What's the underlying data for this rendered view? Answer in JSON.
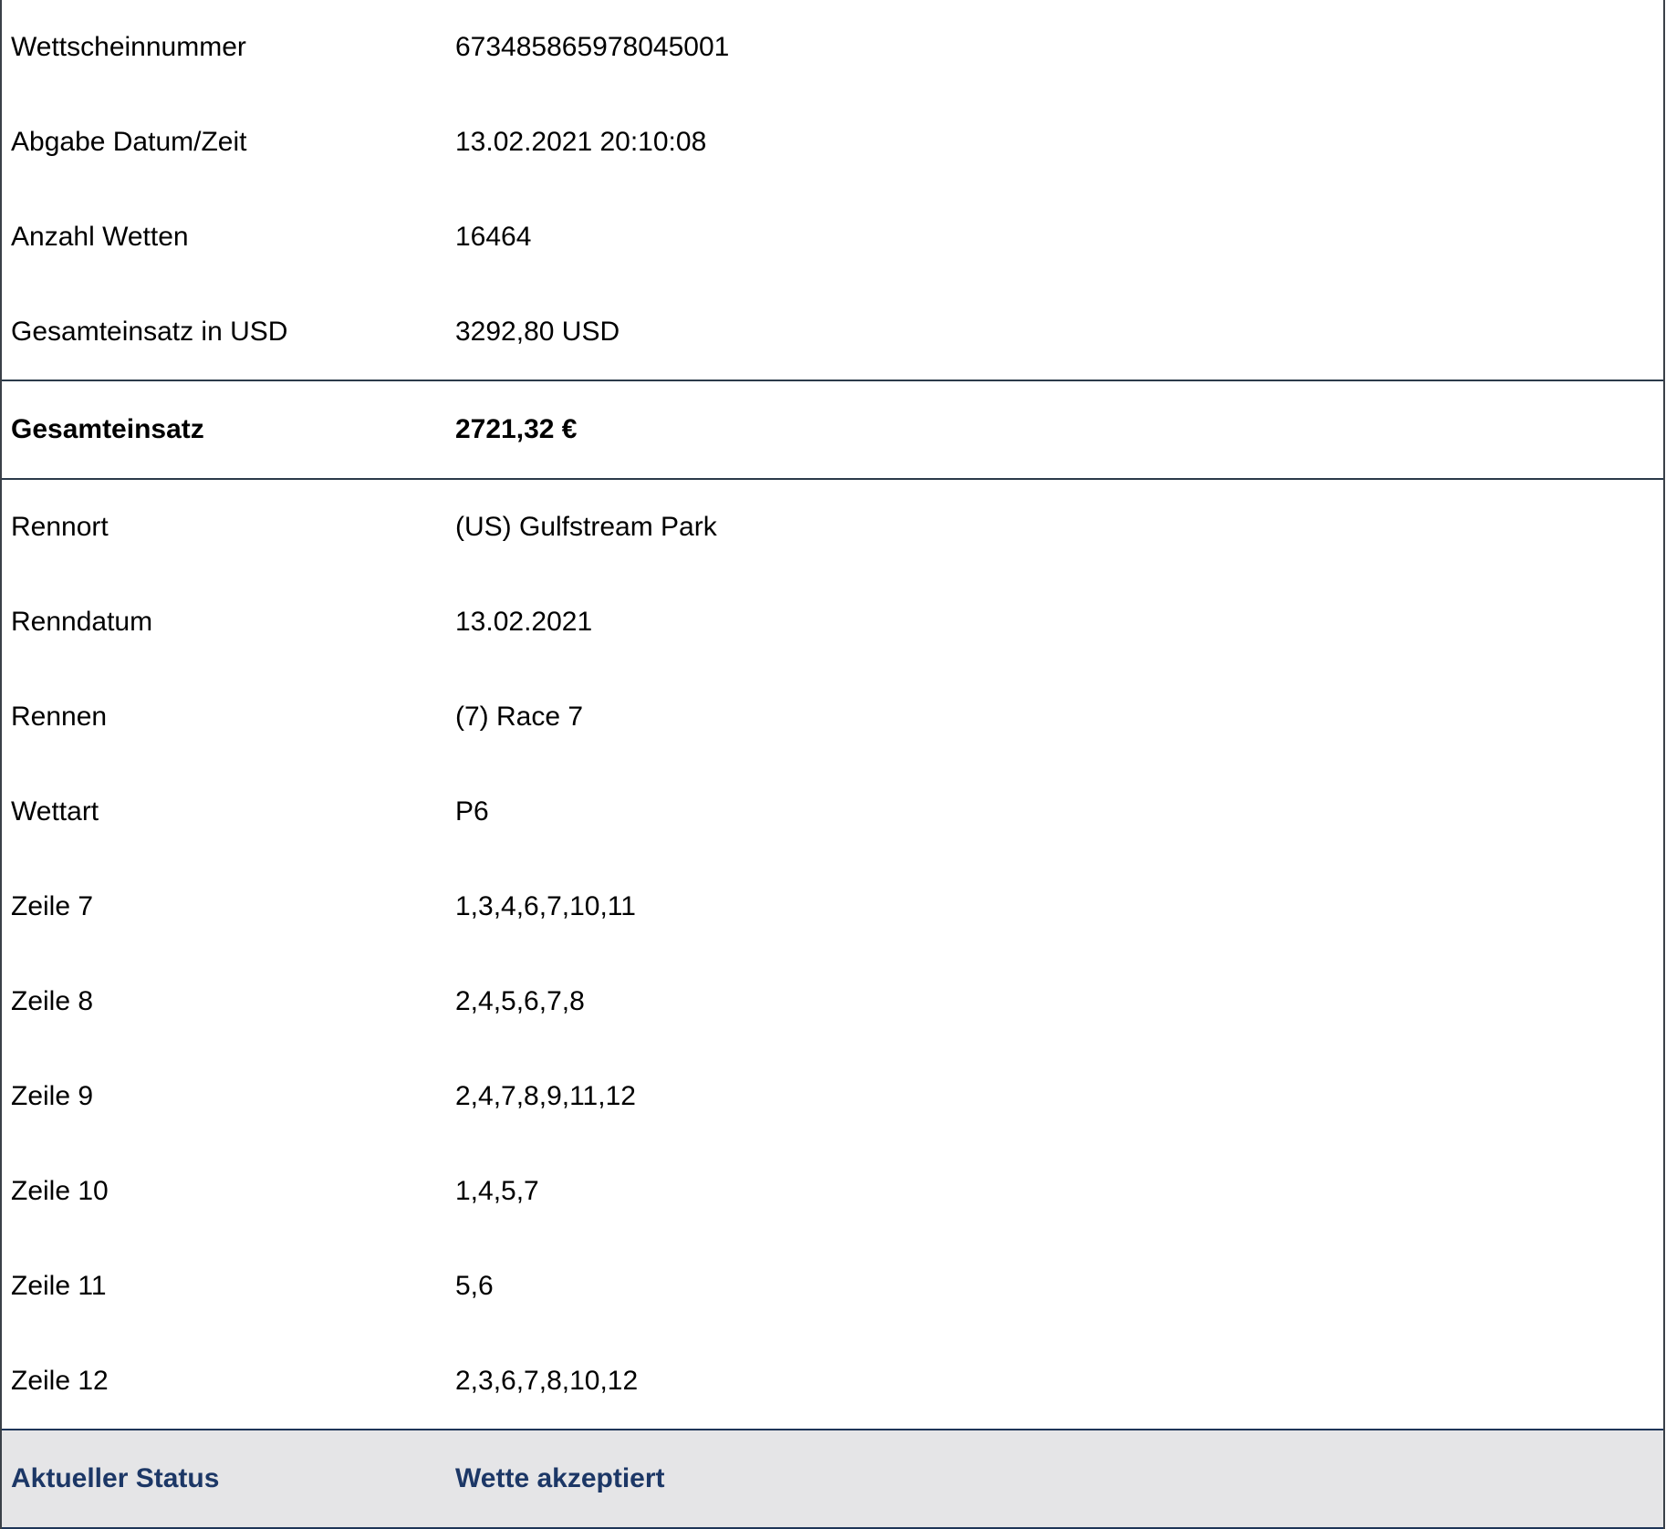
{
  "header_rows": [
    {
      "label": "Wettscheinnummer",
      "value": "673485865978045001"
    },
    {
      "label": "Abgabe Datum/Zeit",
      "value": "13.02.2021 20:10:08"
    },
    {
      "label": "Anzahl Wetten",
      "value": "16464"
    },
    {
      "label": "Gesamteinsatz in USD",
      "value": "3292,80 USD"
    }
  ],
  "total": {
    "label": "Gesamteinsatz",
    "value": "2721,32 €"
  },
  "race_rows": [
    {
      "label": "Rennort",
      "value": "(US) Gulfstream Park"
    },
    {
      "label": "Renndatum",
      "value": "13.02.2021"
    },
    {
      "label": "Rennen",
      "value": "(7) Race 7"
    },
    {
      "label": "Wettart",
      "value": "P6"
    },
    {
      "label": "Zeile 7",
      "value": "1,3,4,6,7,10,11"
    },
    {
      "label": "Zeile 8",
      "value": "2,4,5,6,7,8"
    },
    {
      "label": "Zeile 9",
      "value": "2,4,7,8,9,11,12"
    },
    {
      "label": "Zeile 10",
      "value": "1,4,5,7"
    },
    {
      "label": "Zeile 11",
      "value": "5,6"
    },
    {
      "label": "Zeile 12",
      "value": "2,3,6,7,8,10,12"
    }
  ],
  "status": {
    "label": "Aktueller Status",
    "value": "Wette akzeptiert"
  },
  "colors": {
    "status_text": "#1c3766",
    "status_background": "#e5e5e7",
    "divider": "#2b3a4a"
  }
}
